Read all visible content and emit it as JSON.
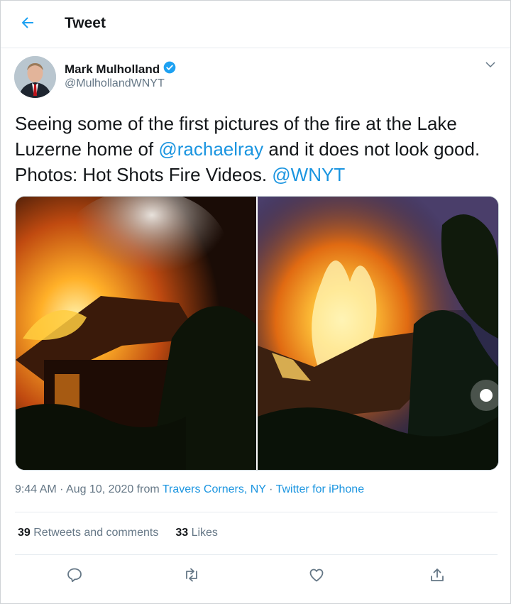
{
  "header": {
    "title": "Tweet"
  },
  "author": {
    "name": "Mark Mulholland",
    "handle": "@MulhollandWNYT"
  },
  "tweet": {
    "text_1": "Seeing some of the first pictures of the fire at the Lake Luzerne home of ",
    "mention_1": "@rachaelray",
    "text_2": " and it does not look good. Photos: Hot Shots Fire Videos. ",
    "mention_2": "@WNYT"
  },
  "meta": {
    "time": "9:44 AM · Aug 10, 2020 from ",
    "location": "Travers Corners, NY",
    "sep": " · ",
    "source": "Twitter for iPhone"
  },
  "stats": {
    "retweets_count": "39",
    "retweets_label": "Retweets and comments",
    "likes_count": "33",
    "likes_label": "Likes"
  },
  "icons": [
    "back-arrow-icon",
    "verified-badge-icon",
    "chevron-down-icon",
    "reply-icon",
    "retweet-icon",
    "like-icon",
    "share-icon"
  ],
  "colors": {
    "link": "#1b95e0",
    "secondary": "#657786",
    "verified": "#1da1f2"
  }
}
